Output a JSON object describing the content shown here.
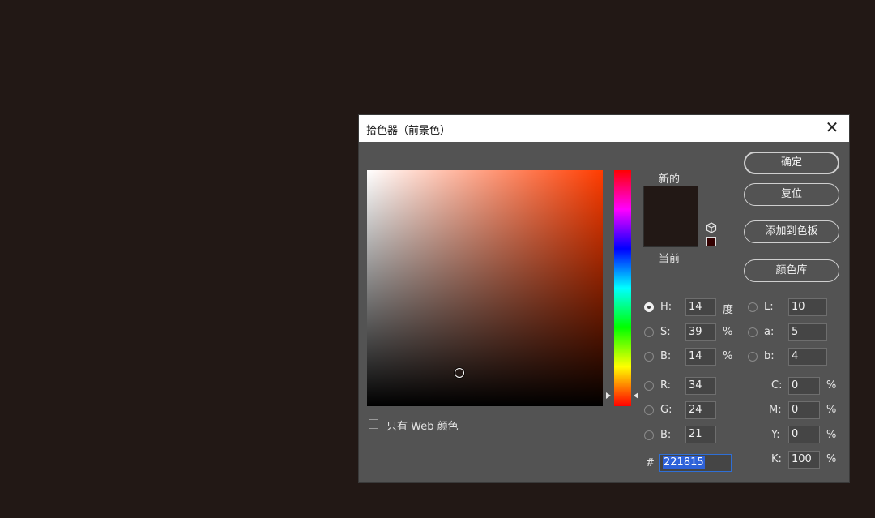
{
  "dialog": {
    "title": "拾色器（前景色）",
    "close_symbol": "✕"
  },
  "preview": {
    "new_label": "新的",
    "current_label": "当前",
    "color": "#221815",
    "websafe_color": "#330000"
  },
  "buttons": {
    "ok": "确定",
    "reset": "复位",
    "add_to_swatches": "添加到色板",
    "color_libraries": "颜色库"
  },
  "hsb": {
    "h": {
      "label": "H:",
      "value": "14",
      "unit": "度"
    },
    "s": {
      "label": "S:",
      "value": "39",
      "unit": "%"
    },
    "b": {
      "label": "B:",
      "value": "14",
      "unit": "%"
    }
  },
  "rgb": {
    "r": {
      "label": "R:",
      "value": "34"
    },
    "g": {
      "label": "G:",
      "value": "24"
    },
    "b": {
      "label": "B:",
      "value": "21"
    }
  },
  "lab": {
    "l": {
      "label": "L:",
      "value": "10"
    },
    "a": {
      "label": "a:",
      "value": "5"
    },
    "b": {
      "label": "b:",
      "value": "4"
    }
  },
  "cmyk": {
    "c": {
      "label": "C:",
      "value": "0",
      "unit": "%"
    },
    "m": {
      "label": "M:",
      "value": "0",
      "unit": "%"
    },
    "y": {
      "label": "Y:",
      "value": "0",
      "unit": "%"
    },
    "k": {
      "label": "K:",
      "value": "100",
      "unit": "%"
    }
  },
  "hex": {
    "label": "#",
    "value": "221815"
  },
  "web_only": {
    "label": "只有 Web 颜色",
    "checked": false
  },
  "selected_mode": "H"
}
